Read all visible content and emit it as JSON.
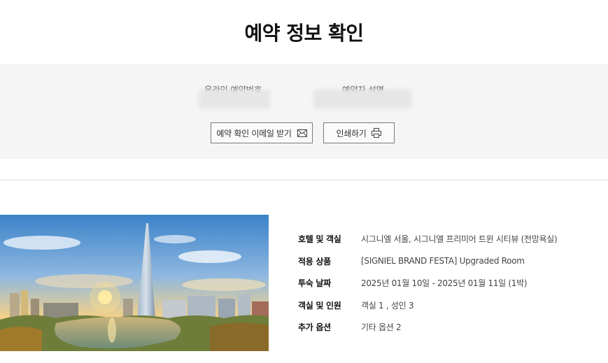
{
  "page": {
    "title": "예약 정보 확인"
  },
  "reservation_info": {
    "online_number_label": "온라인 예약번호",
    "booker_name_label": "예약자 성명"
  },
  "actions": {
    "email_button_label": "예약 확인 이메일 받기",
    "print_button_label": "인쇄하기"
  },
  "details": [
    {
      "key": "호텔 및 객실",
      "value": "시그니엘 서울, 시그니엘 프리미어 트윈 시티뷰 (전망욕실)"
    },
    {
      "key": "적용 상품",
      "value": "[SIGNIEL BRAND FESTA] Upgraded Room"
    },
    {
      "key": "투숙 날짜",
      "value": "2025년 01월 10일 - 2025년 01월 11일 (1박)"
    },
    {
      "key": "객실 및 인원",
      "value": "객실 1 , 성인 3"
    },
    {
      "key": "추가 옵션",
      "value": "기타 옵션 2"
    }
  ],
  "icons": {
    "email": "envelope-icon",
    "print": "printer-icon"
  }
}
